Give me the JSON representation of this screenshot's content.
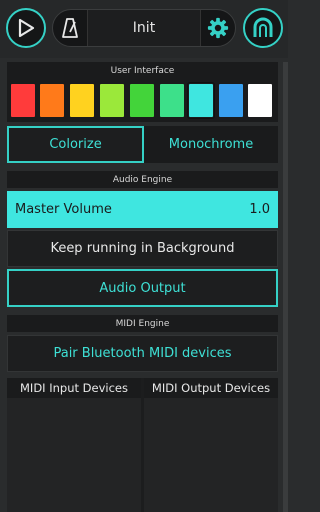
{
  "header": {
    "preset_name": "Init",
    "icons": [
      "play-icon",
      "metronome-icon",
      "gear-icon",
      "magnet-icon"
    ]
  },
  "user_interface": {
    "section_title": "User Interface",
    "swatches": [
      "#ff3b3b",
      "#ff7a1a",
      "#ffd21f",
      "#9be83a",
      "#43d43a",
      "#3de08a",
      "#3fe6e0",
      "#3aa0f0",
      "#ffffff"
    ],
    "selected_swatch": 6,
    "colorize_label": "Colorize",
    "monochrome_label": "Monochrome"
  },
  "audio_engine": {
    "section_title": "Audio Engine",
    "master_volume_label": "Master Volume",
    "master_volume_value": "1.0",
    "keep_running_label": "Keep running in Background",
    "audio_output_label": "Audio Output"
  },
  "midi_engine": {
    "section_title": "MIDI Engine",
    "pair_bluetooth_label": "Pair Bluetooth MIDI devices",
    "input_devices_label": "MIDI Input Devices",
    "output_devices_label": "MIDI Output Devices"
  },
  "colors": {
    "accent": "#35d1c6",
    "background": "#2a2c2d",
    "panel": "#1a1b1c"
  }
}
